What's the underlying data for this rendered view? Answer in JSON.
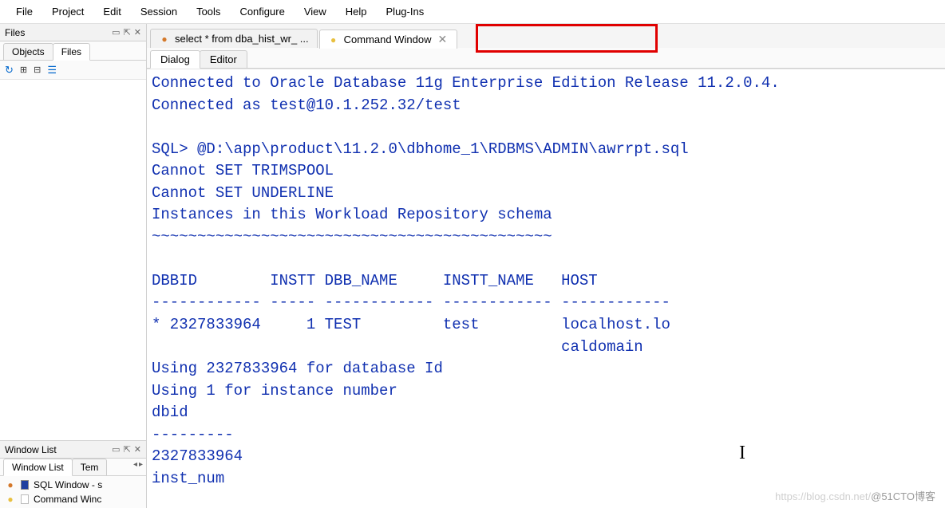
{
  "menu": [
    "File",
    "Project",
    "Edit",
    "Session",
    "Tools",
    "Configure",
    "View",
    "Help",
    "Plug-Ins"
  ],
  "files_panel": {
    "title": "Files",
    "controls": [
      "▭",
      "⇱",
      "✕"
    ],
    "tabs": {
      "objects": "Objects",
      "files": "Files"
    }
  },
  "window_list_panel": {
    "title": "Window List",
    "controls": [
      "▭",
      "⇱",
      "✕"
    ],
    "tabs": {
      "window_list": "Window List",
      "templates": "Tem"
    },
    "items": [
      {
        "icon": "sql",
        "label": "SQL Window - s"
      },
      {
        "icon": "cmd",
        "label": "Command Winc"
      }
    ]
  },
  "doc_tabs": {
    "tab1": {
      "label": "select * from dba_hist_wr_ ..."
    },
    "tab2": {
      "label": "Command Window"
    }
  },
  "sub_tabs": {
    "dialog": "Dialog",
    "editor": "Editor"
  },
  "console_text": "Connected to Oracle Database 11g Enterprise Edition Release 11.2.0.4.\nConnected as test@10.1.252.32/test\n\nSQL> @D:\\app\\product\\11.2.0\\dbhome_1\\RDBMS\\ADMIN\\awrrpt.sql\nCannot SET TRIMSPOOL\nCannot SET UNDERLINE\nInstances in this Workload Repository schema\n~~~~~~~~~~~~~~~~~~~~~~~~~~~~~~~~~~~~~~~~~~~~\n\nDBBID        INSTT DBB_NAME     INSTT_NAME   HOST\n------------ ----- ------------ ------------ ------------\n* 2327833964     1 TEST         test         localhost.lo\n                                             caldomain\nUsing 2327833964 for database Id\nUsing 1 for instance number\ndbid\n---------\n2327833964\ninst_num",
  "watermark": {
    "prefix": "https://blog.csdn.net/",
    "suffix": "@51CTO博客"
  }
}
